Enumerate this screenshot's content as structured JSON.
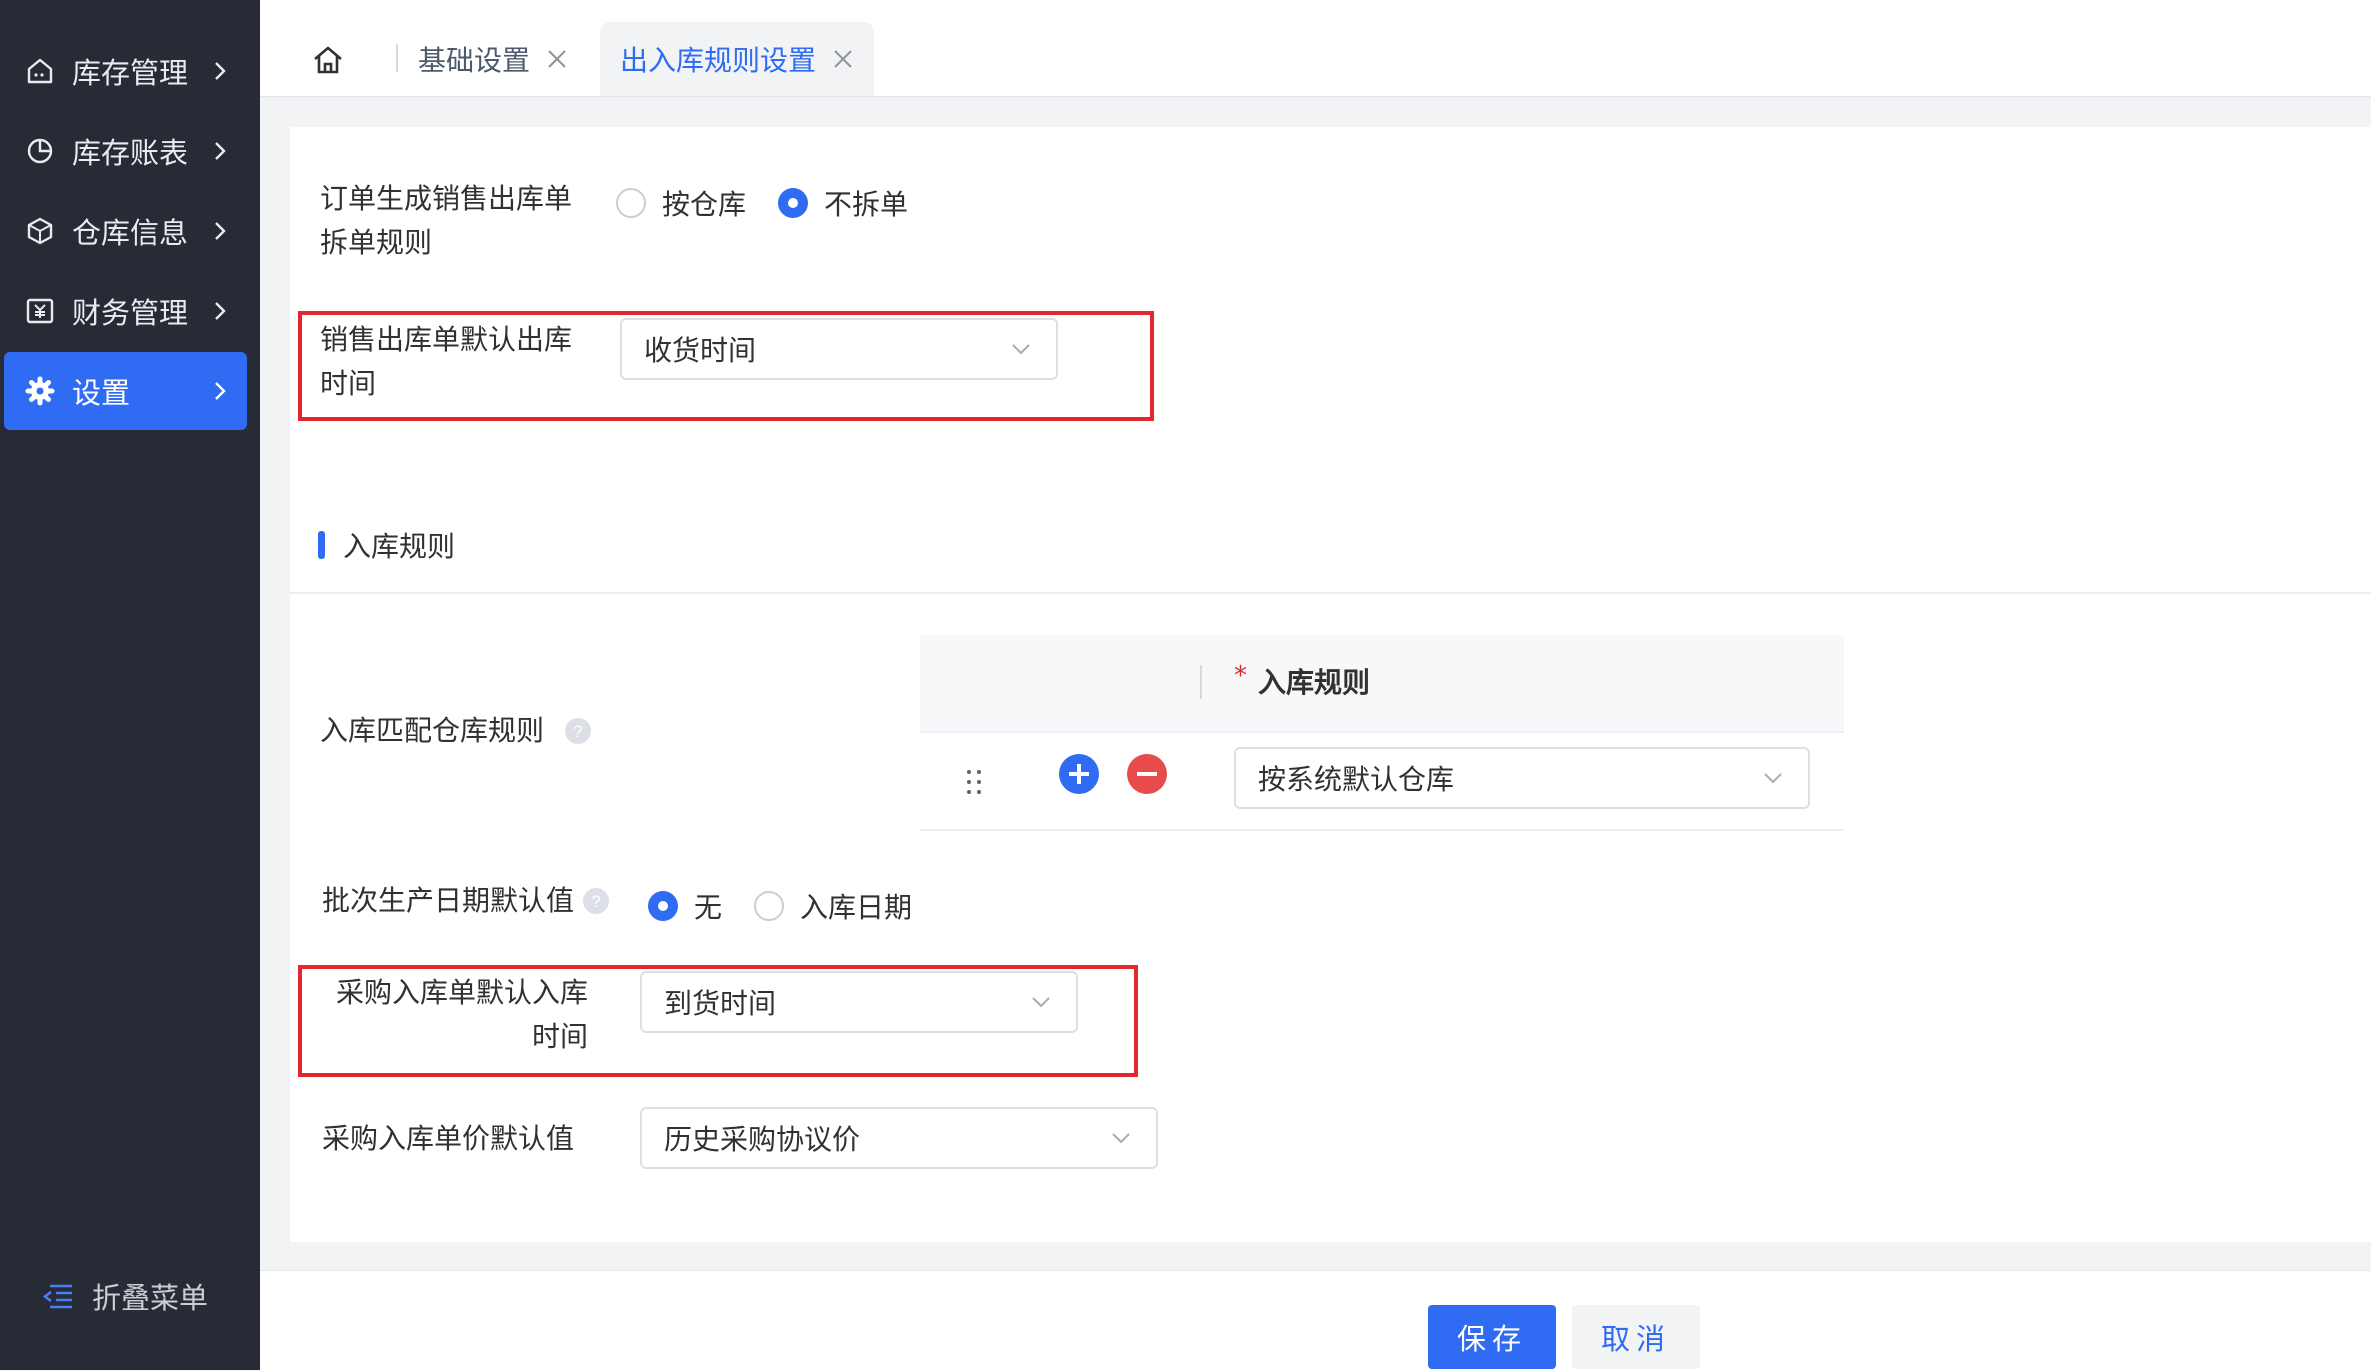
{
  "sidebar": {
    "items": [
      {
        "label": "库存管理",
        "icon": "inventory-icon"
      },
      {
        "label": "库存账表",
        "icon": "pie-chart-icon"
      },
      {
        "label": "仓库信息",
        "icon": "cube-icon"
      },
      {
        "label": "财务管理",
        "icon": "finance-icon"
      },
      {
        "label": "设置",
        "icon": "gear-icon",
        "active": true
      }
    ],
    "collapse_label": "折叠菜单"
  },
  "tabs": [
    {
      "label": "基础设置",
      "active": false
    },
    {
      "label": "出入库规则设置",
      "active": true
    }
  ],
  "form": {
    "split_rule": {
      "label_line1": "订单生成销售出库单",
      "label_line2": "拆单规则",
      "options": [
        "按仓库",
        "不拆单"
      ],
      "selected": "不拆单"
    },
    "sales_out_time": {
      "label_line1": "销售出库单默认出库",
      "label_line2": "时间",
      "value": "收货时间"
    },
    "inbound_section_title": "入库规则",
    "match_rule": {
      "label": "入库匹配仓库规则",
      "column_header": "入库规则",
      "required_mark": "*",
      "row_value": "按系统默认仓库"
    },
    "batch_date": {
      "label": "批次生产日期默认值",
      "options": [
        "无",
        "入库日期"
      ],
      "selected": "无"
    },
    "purchase_in_time": {
      "label_line1": "采购入库单默认入库",
      "label_line2": "时间",
      "value": "到货时间"
    },
    "purchase_price": {
      "label": "采购入库单价默认值",
      "value": "历史采购协议价"
    }
  },
  "footer": {
    "save_label": "保存",
    "cancel_label": "取消"
  },
  "colors": {
    "primary": "#2f6bf3",
    "sidebar_bg": "#262b35",
    "highlight_red": "#e32730",
    "remove_red": "#e84b4b"
  }
}
